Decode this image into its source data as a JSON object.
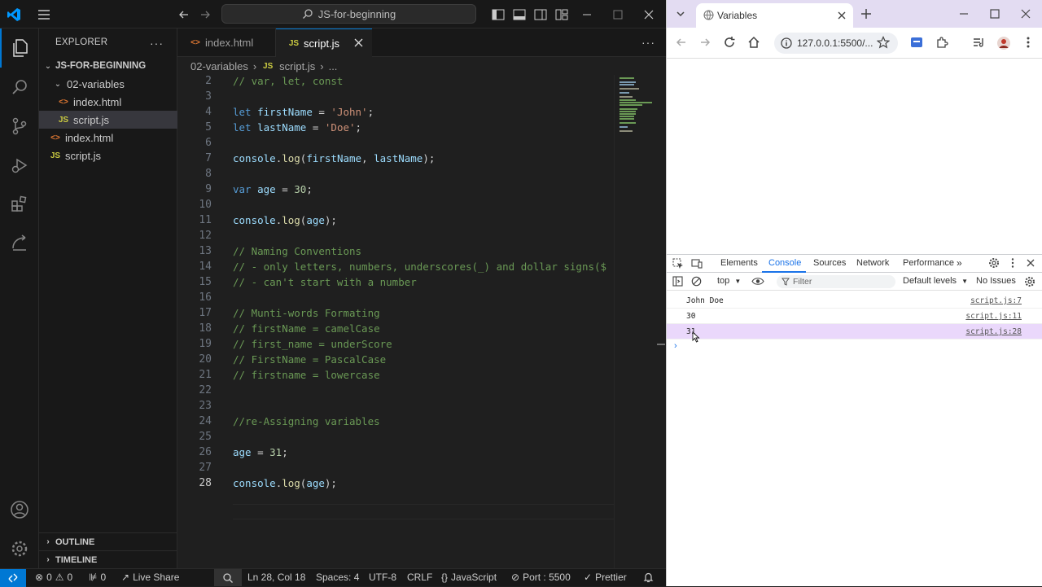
{
  "vscode": {
    "title_search": "JS-for-beginning",
    "explorer_title": "EXPLORER",
    "root_folder": "JS-FOR-BEGINNING",
    "tree": [
      {
        "label": "02-variables",
        "type": "folder"
      },
      {
        "label": "index.html",
        "type": "html"
      },
      {
        "label": "script.js",
        "type": "js"
      },
      {
        "label": "index.html",
        "type": "html"
      },
      {
        "label": "script.js",
        "type": "js"
      }
    ],
    "outline_label": "OUTLINE",
    "timeline_label": "TIMELINE",
    "tabs": [
      {
        "label": "index.html",
        "icon": "html-file-icon"
      },
      {
        "label": "script.js",
        "icon": "js-file-icon"
      }
    ],
    "breadcrumb": {
      "folder": "02-variables",
      "file": "script.js",
      "more": "..."
    },
    "line_numbers": [
      "2",
      "3",
      "4",
      "5",
      "6",
      "7",
      "8",
      "9",
      "10",
      "11",
      "12",
      "13",
      "14",
      "15",
      "16",
      "17",
      "18",
      "19",
      "20",
      "21",
      "22",
      "23",
      "24",
      "25",
      "26",
      "27",
      "28"
    ],
    "code": {
      "l2": "// var, let, const",
      "l13": "// Naming Conventions",
      "l14": "// - only letters, numbers, underscores(_) and dollar signs($",
      "l15": "// - can't start with a number",
      "l17": "// Munti-words Formating",
      "l18": "// firstName = camelCase",
      "l19": "// first_name = underScore",
      "l20": "// FirstName = PascalCase",
      "l21": "// firstname = lowercase",
      "l24": "//re-Assigning variables"
    },
    "status": {
      "errors": "0",
      "warnings": "0",
      "ports": "0",
      "live_share": "Live Share",
      "cursor": "Ln 28, Col 18",
      "spaces": "Spaces: 4",
      "encoding": "UTF-8",
      "eol": "CRLF",
      "language": "JavaScript",
      "port": "Port : 5500",
      "prettier": "Prettier"
    }
  },
  "browser": {
    "tab_title": "Variables",
    "url": "127.0.0.1:5500/...",
    "devtools": {
      "tabs": [
        "Elements",
        "Console",
        "Sources",
        "Network",
        "Performance"
      ],
      "context": "top",
      "filter_placeholder": "Filter",
      "levels": "Default levels",
      "issues": "No Issues",
      "console": [
        {
          "message": "John Doe",
          "source": "script.js:7"
        },
        {
          "message": "30",
          "source": "script.js:11"
        },
        {
          "message": "31",
          "source": "script.js:28"
        }
      ]
    }
  },
  "colors": {
    "accent": "#0078d4",
    "keyword": "#569cd6",
    "variable": "#9cdcfe",
    "string": "#ce9178",
    "function": "#dcdcaa",
    "number": "#b5cea8",
    "comment": "#6a9955"
  }
}
